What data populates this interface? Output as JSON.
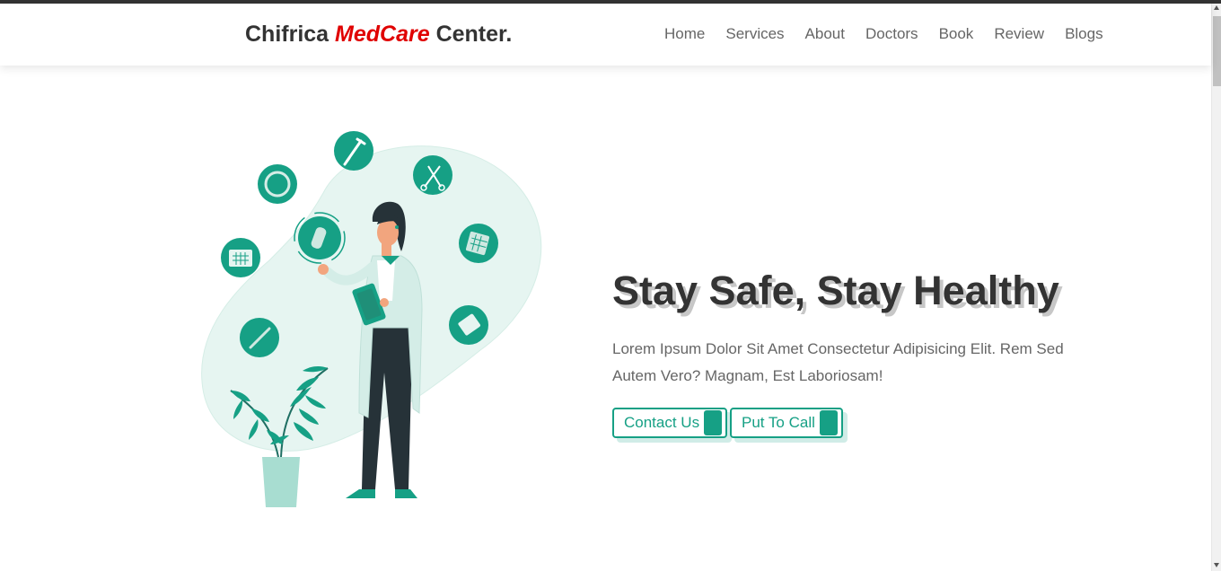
{
  "header": {
    "logo": {
      "part1": "Chifrica ",
      "accent": "MedCare",
      "part2": " Center."
    },
    "nav": [
      "Home",
      "Services",
      "About",
      "Doctors",
      "Book",
      "Review",
      "Blogs"
    ]
  },
  "hero": {
    "title": "Stay Safe, Stay Healthy",
    "text": "Lorem Ipsum Dolor Sit Amet Consectetur Adipisicing Elit. Rem Sed Autem Vero? Magnam, Est Laboriosam!",
    "buttons": {
      "contact": "Contact Us",
      "call": "Put To Call"
    }
  },
  "colors": {
    "accent": "#16a085",
    "logo_accent": "#e00000",
    "text": "#333333",
    "muted": "#666666",
    "blob": "#e6f5f1"
  },
  "icons": [
    "syringe-icon",
    "scissors-icon",
    "ring-icon",
    "capsule-icon",
    "calendar-icon",
    "pill-pack-icon",
    "thermometer-icon",
    "pill-blister-icon",
    "plant-icon",
    "doctor-figure"
  ]
}
